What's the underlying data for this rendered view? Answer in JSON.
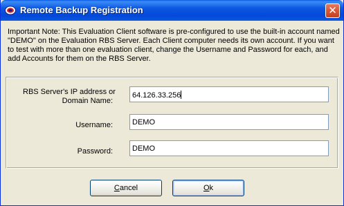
{
  "window": {
    "title": "Remote Backup Registration",
    "close_glyph": "✕"
  },
  "note": {
    "text": "Important Note: This Evaluation Client software is pre-configured to use the built-in account named \"DEMO\" on the Evaluation RBS Server. Each Client computer needs its own account. If you want to test with more than one evaluation client, change the Username and Password for each, and add Accounts for them on the RBS Server."
  },
  "form": {
    "server": {
      "label_line1": "RBS Server's IP address or",
      "label_line2": "Domain Name:",
      "value": "64.126.33.256"
    },
    "username": {
      "label": "Username:",
      "value": "DEMO"
    },
    "password": {
      "label": "Password:",
      "value": "DEMO"
    }
  },
  "buttons": {
    "cancel": {
      "accel": "C",
      "rest": "ancel"
    },
    "ok": {
      "accel": "O",
      "rest": "k"
    }
  },
  "icons": {
    "app": "app-logo-icon",
    "close": "close-icon"
  },
  "colors": {
    "titlebar": "#0c58e3",
    "dialog_bg": "#ece9d8",
    "close_button": "#d8573a",
    "input_border": "#7f9db9"
  }
}
